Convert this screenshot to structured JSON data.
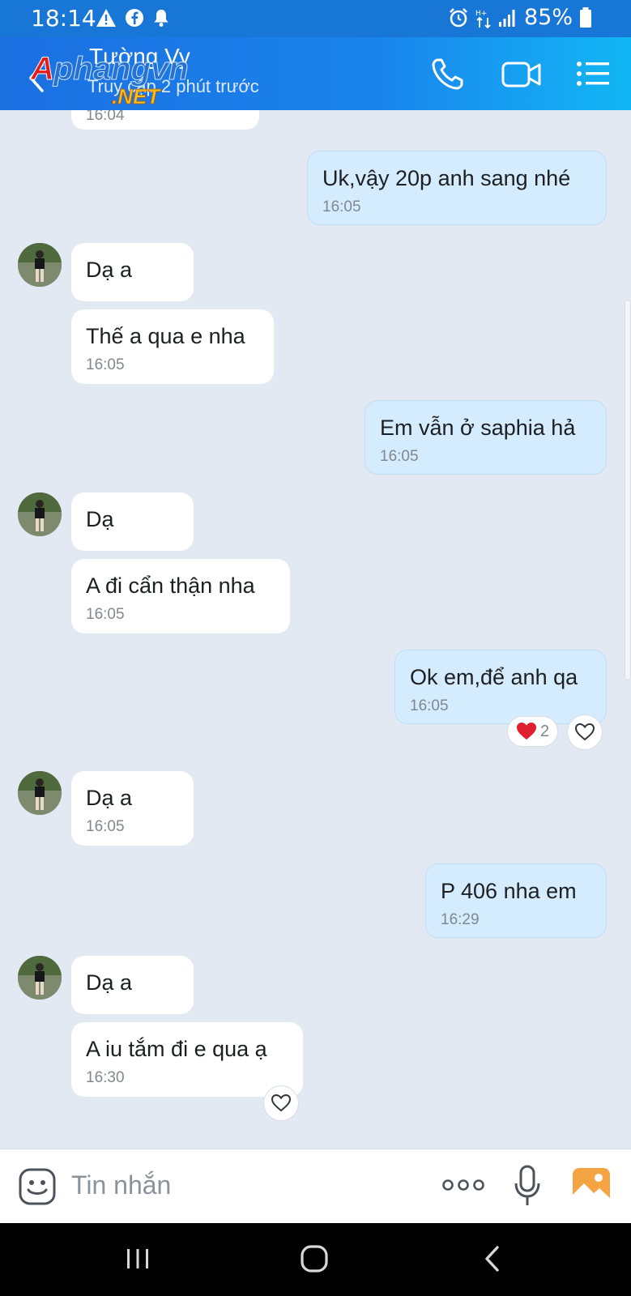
{
  "status_bar": {
    "time": "18:14",
    "battery": "85%",
    "left_icons": [
      "warning-icon",
      "facebook-icon",
      "notification-bell-icon"
    ],
    "right_icons": [
      "alarm-icon",
      "data-arrows-icon",
      "signal-icon",
      "battery-icon"
    ]
  },
  "header": {
    "contact_name": "Tường Vy",
    "last_seen": "Truy cập 2 phút trước",
    "watermark_top": "Aphangvn",
    "watermark_bottom": ".NET",
    "icons": [
      "back-icon",
      "phone-icon",
      "video-call-icon",
      "menu-list-icon"
    ]
  },
  "messages": [
    {
      "side": "in",
      "text": "",
      "time": "16:04"
    },
    {
      "side": "out",
      "text": "Uk,vậy 20p anh sang nhé",
      "time": "16:05"
    },
    {
      "side": "in",
      "text": "Dạ a",
      "time": ""
    },
    {
      "side": "in",
      "text": "Thế a qua e nha",
      "time": "16:05"
    },
    {
      "side": "out",
      "text": "Em vẫn ở saphia hả",
      "time": "16:05"
    },
    {
      "side": "in",
      "text": "Dạ",
      "time": ""
    },
    {
      "side": "in",
      "text": "A đi cẩn thận nha",
      "time": "16:05"
    },
    {
      "side": "out",
      "text": "Ok em,để anh qa",
      "time": "16:05",
      "reaction_count": "2"
    },
    {
      "side": "in",
      "text": "Dạ a",
      "time": "16:05"
    },
    {
      "side": "out",
      "text": "P 406 nha em",
      "time": "16:29"
    },
    {
      "side": "in",
      "text": "Dạ a",
      "time": ""
    },
    {
      "side": "in",
      "text": "A iu tắm đi e qua ạ",
      "time": "16:30"
    }
  ],
  "composer": {
    "placeholder": "Tin nhắn",
    "icons": [
      "sticker-icon",
      "more-dots-icon",
      "microphone-icon",
      "photo-icon"
    ]
  },
  "colors": {
    "header_start": "#1b6fe0",
    "header_end": "#12b6f4",
    "chat_background": "#e3e9f2",
    "outgoing_bubble": "#d4ecfd",
    "incoming_bubble": "#ffffff",
    "heart_red": "#e0202e"
  },
  "navbar": {
    "icons": [
      "recent-apps-icon",
      "home-icon",
      "back-nav-icon"
    ]
  }
}
